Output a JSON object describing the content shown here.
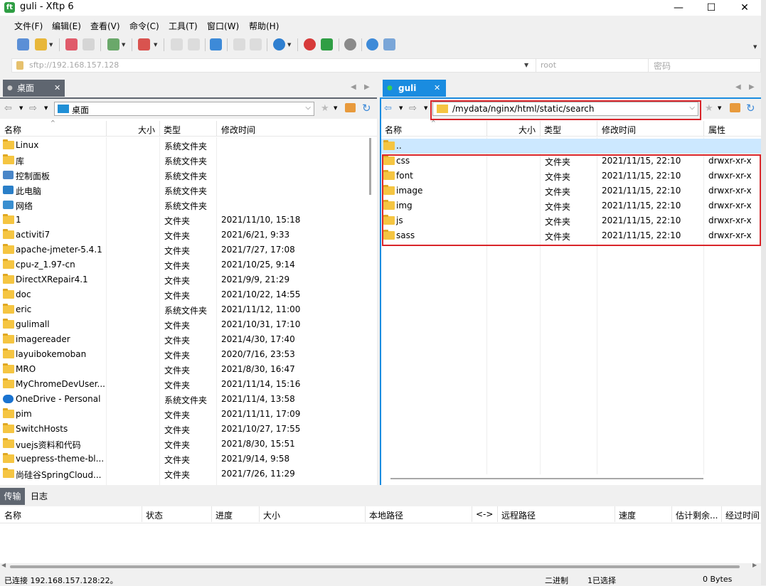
{
  "window": {
    "title": "guli - Xftp 6",
    "icon_letter": "ft",
    "minimize": "—",
    "maximize": "☐",
    "close": "✕"
  },
  "menu": [
    "文件(F)",
    "编辑(E)",
    "查看(V)",
    "命令(C)",
    "工具(T)",
    "窗口(W)",
    "帮助(H)"
  ],
  "address": {
    "host": "sftp://192.168.157.128",
    "user": "root",
    "password_placeholder": "密码"
  },
  "left_panel": {
    "tab": "桌面",
    "path": "桌面",
    "columns": [
      "名称",
      "大小",
      "类型",
      "修改时间"
    ],
    "rows": [
      {
        "name": "Linux",
        "type": "系统文件夹",
        "modified": "",
        "icon": "folder"
      },
      {
        "name": "库",
        "type": "系统文件夹",
        "modified": "",
        "icon": "folder"
      },
      {
        "name": "控制面板",
        "type": "系统文件夹",
        "modified": "",
        "icon": "control-panel"
      },
      {
        "name": "此电脑",
        "type": "系统文件夹",
        "modified": "",
        "icon": "computer"
      },
      {
        "name": "网络",
        "type": "系统文件夹",
        "modified": "",
        "icon": "network"
      },
      {
        "name": "1",
        "type": "文件夹",
        "modified": "2021/11/10, 15:18",
        "icon": "folder"
      },
      {
        "name": "activiti7",
        "type": "文件夹",
        "modified": "2021/6/21, 9:33",
        "icon": "folder"
      },
      {
        "name": "apache-jmeter-5.4.1",
        "type": "文件夹",
        "modified": "2021/7/27, 17:08",
        "icon": "folder"
      },
      {
        "name": "cpu-z_1.97-cn",
        "type": "文件夹",
        "modified": "2021/10/25, 9:14",
        "icon": "folder"
      },
      {
        "name": "DirectXRepair4.1",
        "type": "文件夹",
        "modified": "2021/9/9, 21:29",
        "icon": "folder"
      },
      {
        "name": "doc",
        "type": "文件夹",
        "modified": "2021/10/22, 14:55",
        "icon": "folder"
      },
      {
        "name": "eric",
        "type": "系统文件夹",
        "modified": "2021/11/12, 11:00",
        "icon": "folder"
      },
      {
        "name": "gulimall",
        "type": "文件夹",
        "modified": "2021/10/31, 17:10",
        "icon": "folder"
      },
      {
        "name": "imagereader",
        "type": "文件夹",
        "modified": "2021/4/30, 17:40",
        "icon": "folder"
      },
      {
        "name": "layuibokemoban",
        "type": "文件夹",
        "modified": "2020/7/16, 23:53",
        "icon": "folder"
      },
      {
        "name": "MRO",
        "type": "文件夹",
        "modified": "2021/8/30, 16:47",
        "icon": "folder"
      },
      {
        "name": "MyChromeDevUser...",
        "type": "文件夹",
        "modified": "2021/11/14, 15:16",
        "icon": "folder"
      },
      {
        "name": "OneDrive - Personal",
        "type": "系统文件夹",
        "modified": "2021/11/4, 13:58",
        "icon": "onedrive"
      },
      {
        "name": "pim",
        "type": "文件夹",
        "modified": "2021/11/11, 17:09",
        "icon": "folder"
      },
      {
        "name": "SwitchHosts",
        "type": "文件夹",
        "modified": "2021/10/27, 17:55",
        "icon": "folder"
      },
      {
        "name": "vuejs资料和代码",
        "type": "文件夹",
        "modified": "2021/8/30, 15:51",
        "icon": "folder"
      },
      {
        "name": "vuepress-theme-bl...",
        "type": "文件夹",
        "modified": "2021/9/14, 9:58",
        "icon": "folder"
      },
      {
        "name": "尚硅谷SpringCloud...",
        "type": "文件夹",
        "modified": "2021/7/26, 11:29",
        "icon": "folder"
      }
    ]
  },
  "right_panel": {
    "tab": "guli",
    "path": "/mydata/nginx/html/static/search",
    "columns": [
      "名称",
      "大小",
      "类型",
      "修改时间",
      "属性"
    ],
    "parent_label": "..",
    "rows": [
      {
        "name": "css",
        "type": "文件夹",
        "modified": "2021/11/15, 22:10",
        "perm": "drwxr-xr-x"
      },
      {
        "name": "font",
        "type": "文件夹",
        "modified": "2021/11/15, 22:10",
        "perm": "drwxr-xr-x"
      },
      {
        "name": "image",
        "type": "文件夹",
        "modified": "2021/11/15, 22:10",
        "perm": "drwxr-xr-x"
      },
      {
        "name": "img",
        "type": "文件夹",
        "modified": "2021/11/15, 22:10",
        "perm": "drwxr-xr-x"
      },
      {
        "name": "js",
        "type": "文件夹",
        "modified": "2021/11/15, 22:10",
        "perm": "drwxr-xr-x"
      },
      {
        "name": "sass",
        "type": "文件夹",
        "modified": "2021/11/15, 22:10",
        "perm": "drwxr-xr-x"
      }
    ]
  },
  "bottom": {
    "tabs": [
      "传输",
      "日志"
    ],
    "columns": [
      "名称",
      "状态",
      "进度",
      "大小",
      "本地路径",
      "<->",
      "远程路径",
      "速度",
      "估计剩余...",
      "经过时间"
    ]
  },
  "status": {
    "connection": "已连接 192.168.157.128:22。",
    "mode": "二进制",
    "selected": "1已选择",
    "size": "0 Bytes"
  }
}
